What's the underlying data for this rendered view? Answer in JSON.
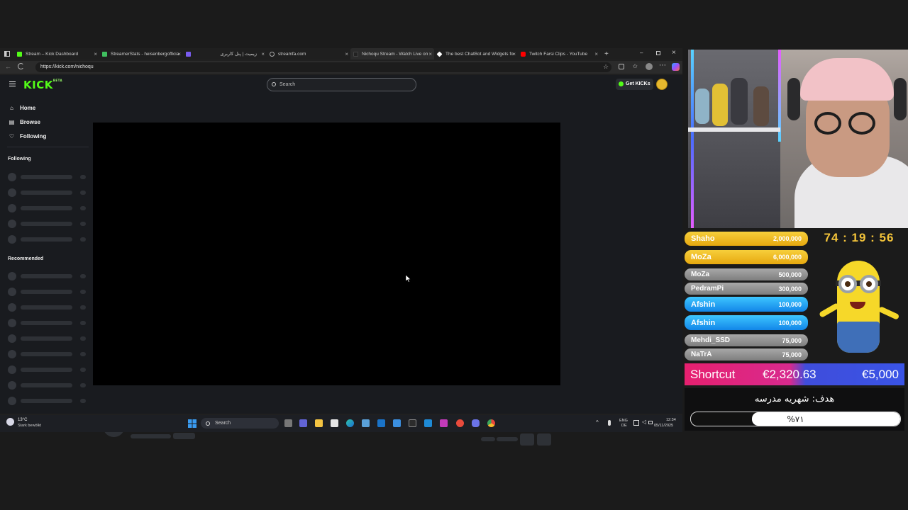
{
  "browser": {
    "tabs": [
      {
        "label": "Stream – Kick Dashboard",
        "color": "#53fc18"
      },
      {
        "label": "StreamerStats - heisenbergofficia",
        "color": "#3fbf5f"
      },
      {
        "label": "",
        "color": "#7a5cf0"
      },
      {
        "label": "زیمیت | پنل کاربری",
        "color": "#888888"
      },
      {
        "label": "streamfa.com",
        "color": "#888888"
      },
      {
        "label": "Nichoqu Stream - Watch Live on",
        "color": "#222222"
      },
      {
        "label": "The best ChatBot and Widgets fo",
        "color": "#ffffff"
      },
      {
        "label": "Twitch Farsi Clips - YouTube",
        "color": "#ff0000"
      }
    ],
    "new_tab": "+",
    "url": "https://kick.com/nichoqu"
  },
  "kick": {
    "logo": "KICK",
    "logo_badge": "BETA",
    "search_placeholder": "Search",
    "get_kicks": "Get KICKs",
    "nav": {
      "home": "Home",
      "browse": "Browse",
      "following": "Following"
    },
    "section_following": "Following",
    "section_recommended": "Recommended"
  },
  "taskbar": {
    "weather_temp": "13°C",
    "weather_desc": "Stark bewölkt",
    "search_placeholder": "Search",
    "lang_top": "ENG",
    "lang_bottom": "DE",
    "time": "12:34",
    "date": "05/11/2025"
  },
  "overlay": {
    "timer": "74 : 19 : 56",
    "donors": [
      {
        "name": "Shaho",
        "amount": "2,000,000",
        "color": "#f0b81c"
      },
      {
        "name": "MoZa",
        "amount": "6,000,000",
        "color": "#f0b81c"
      },
      {
        "name": "MoZa",
        "amount": "500,000",
        "color": "#8e8e8e"
      },
      {
        "name": "PedramPi",
        "amount": "300,000",
        "color": "#8e8e8e"
      },
      {
        "name": "Afshin",
        "amount": "100,000",
        "color": "#1c9ef0"
      },
      {
        "name": "Afshin",
        "amount": "100,000",
        "color": "#1c9ef0"
      },
      {
        "name": "Mehdi_SSD",
        "amount": "75,000",
        "color": "#8e8e8e"
      },
      {
        "name": "NaTrA",
        "amount": "75,000",
        "color": "#8e8e8e"
      }
    ],
    "shortcut_label": "Shortcut",
    "shortcut_current": "€2,320.63",
    "shortcut_target": "€5,000",
    "goal_title": "هدف: شهریه مدرسه",
    "goal_percent_label": "%۷۱",
    "goal_progress": 0.71
  }
}
